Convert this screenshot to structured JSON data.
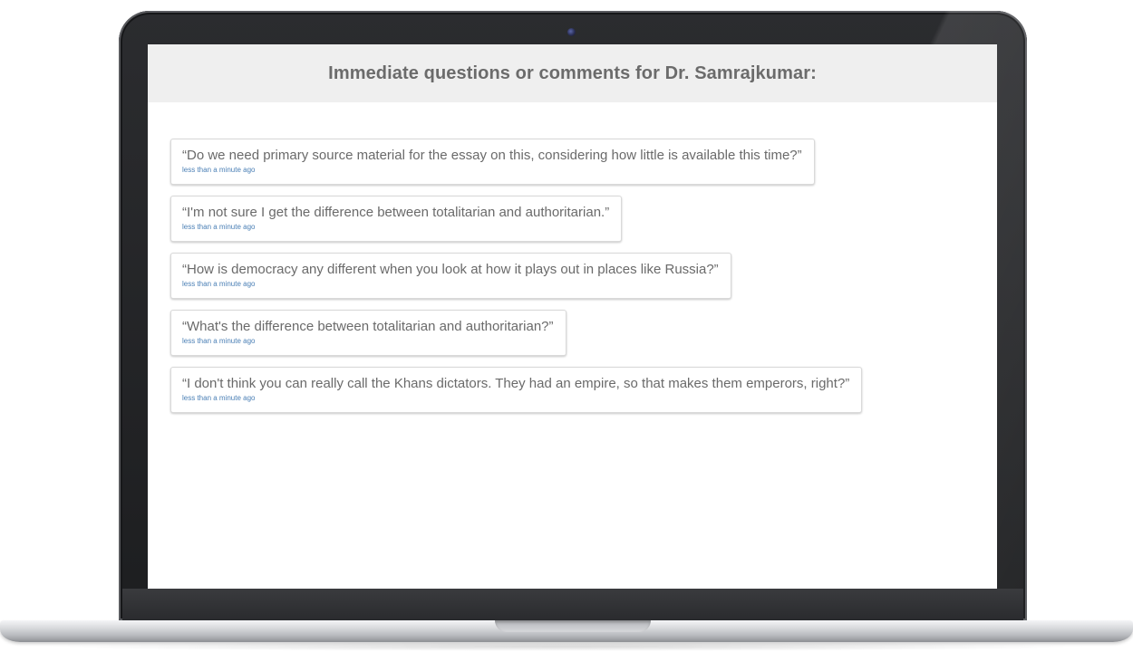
{
  "screen": {
    "title": "Immediate questions or comments for Dr. Samrajkumar:"
  },
  "comments": [
    {
      "text": "“Do we need primary source material for the essay on this, considering how little is available this time?”",
      "time": "less than a minute ago"
    },
    {
      "text": "“I'm not sure I get the difference between totalitarian and authoritarian.”",
      "time": "less than a minute ago"
    },
    {
      "text": "“How is democracy any different when you look at how it plays out in places like Russia?”",
      "time": "less than a minute ago"
    },
    {
      "text": "“What's the difference between totalitarian and authoritarian?”",
      "time": "less than a minute ago"
    },
    {
      "text": "“I don't think you can really call the Khans dictators. They had an empire, so that makes them emperors, right?”",
      "time": "less than a minute ago"
    }
  ],
  "colors": {
    "header_bg": "#efefef",
    "title_text": "#6b6b6b",
    "comment_text": "#6a6a6a",
    "timestamp_link": "#4a7fb5"
  }
}
